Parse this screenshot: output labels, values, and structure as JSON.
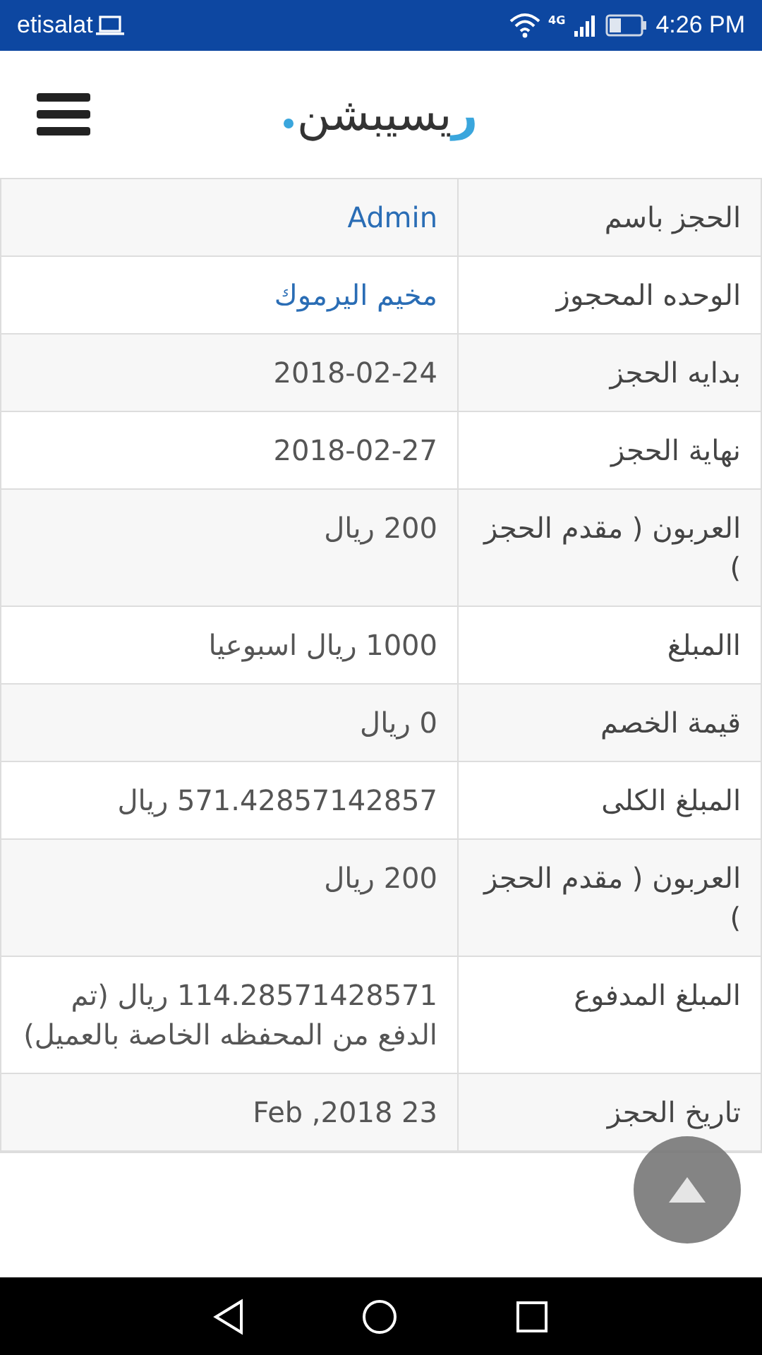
{
  "status_bar": {
    "carrier": "etisalat",
    "network": "4G",
    "time": "4:26 PM"
  },
  "header": {
    "logo": {
      "accent": "ر",
      "rest": "يسيبشن"
    }
  },
  "table": {
    "rows": [
      {
        "label": "الحجز باسم",
        "value": "Admin",
        "kind": "link"
      },
      {
        "label": "الوحده المحجوز",
        "value": "مخيم اليرموك",
        "kind": "link"
      },
      {
        "label": "بدايه الحجز",
        "value": "2018-02-24",
        "kind": "text"
      },
      {
        "label": "نهاية الحجز",
        "value": "2018-02-27",
        "kind": "text"
      },
      {
        "label": "العربون ( مقدم الحجز )",
        "value": "200 ريال",
        "kind": "text"
      },
      {
        "label": "االمبلغ",
        "value": "1000 ريال اسبوعيا",
        "kind": "text"
      },
      {
        "label": "قيمة الخصم",
        "value": "0 ريال",
        "kind": "text"
      },
      {
        "label": "المبلغ الكلى",
        "value": "571.42857142857 ريال",
        "kind": "text"
      },
      {
        "label": "العربون ( مقدم الحجز )",
        "value": "200 ريال",
        "kind": "text"
      },
      {
        "label": "المبلغ المدفوع",
        "value": "114.28571428571 ريال (تم الدفع من المحفظه الخاصة بالعميل)",
        "kind": "text"
      },
      {
        "label": "تاريخ الحجز",
        "value": "Feb ,2018 23",
        "kind": "text"
      }
    ]
  }
}
